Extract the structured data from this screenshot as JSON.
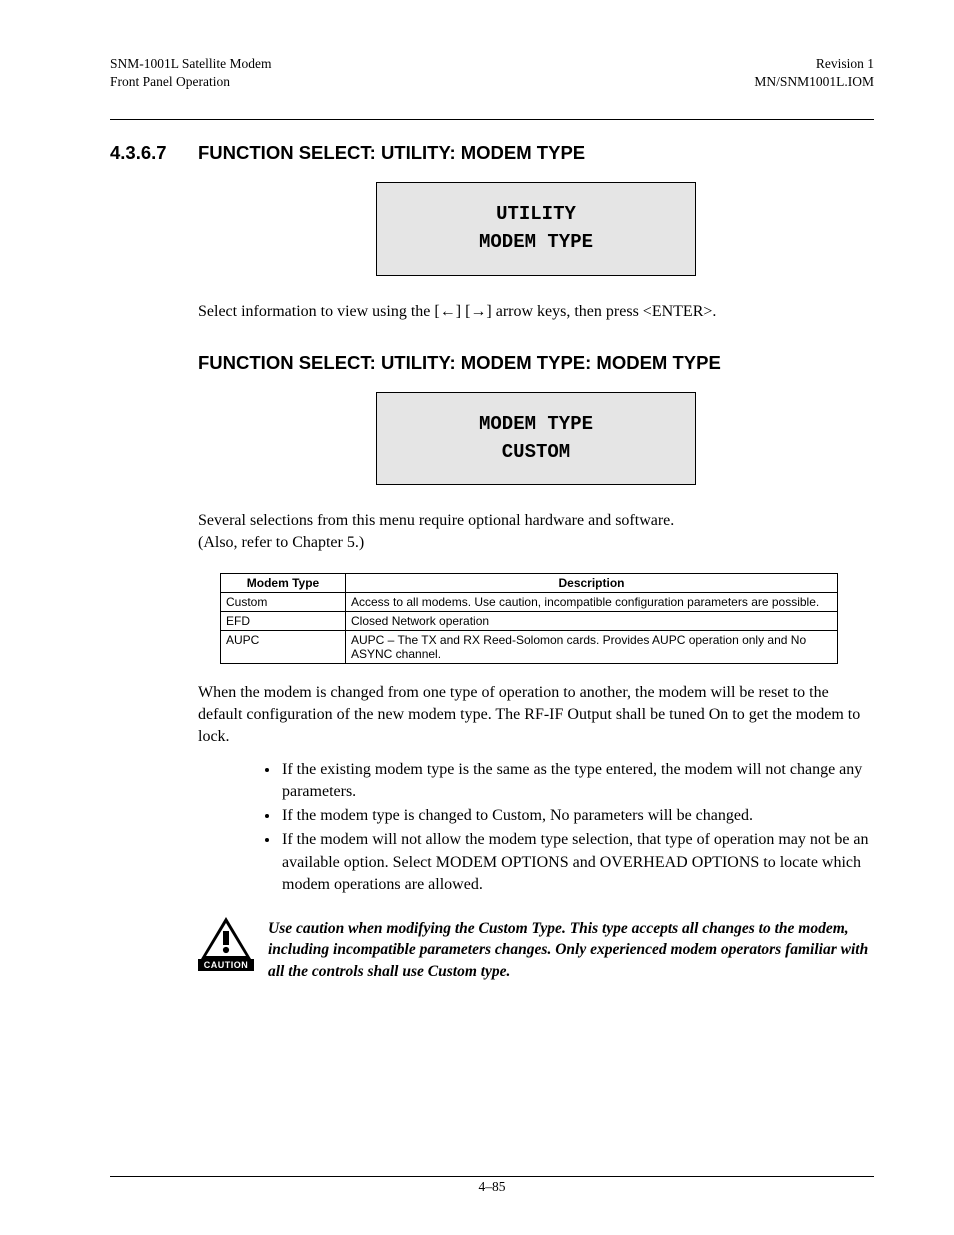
{
  "header": {
    "left1": "SNM-1001L Satellite Modem",
    "left2": "Front Panel Operation",
    "right1": "Revision 1",
    "right2": "MN/SNM1001L.IOM"
  },
  "section": {
    "num": "4.3.6.7",
    "title": "FUNCTION SELECT: UTILITY: MODEM TYPE"
  },
  "lcd1": {
    "line1": "UTILITY",
    "line2": "MODEM TYPE"
  },
  "para1_pre": "Select information to view using the [",
  "para1_mid": "] [",
  "para1_post": "] arrow keys, then press <ENTER>.",
  "subheading": "FUNCTION SELECT: UTILITY: MODEM TYPE: MODEM TYPE",
  "lcd2": {
    "line1": "MODEM TYPE",
    "line2": "CUSTOM"
  },
  "para2a": "Several selections from this menu require optional hardware and software.",
  "para2b": "(Also, refer to Chapter 5.)",
  "table": {
    "head1": "Modem Type",
    "head2": "Description",
    "rows": [
      {
        "type": "Custom",
        "desc": "Access to all modems. Use caution, incompatible configuration parameters are possible."
      },
      {
        "type": "EFD",
        "desc": "Closed Network operation"
      },
      {
        "type": "AUPC",
        "desc": "AUPC – The TX and RX Reed-Solomon cards. Provides AUPC operation only and No ASYNC channel."
      }
    ]
  },
  "para3": "When the modem is changed from one type of operation to another, the modem will be reset to the default configuration of the new modem type. The RF-IF Output shall be tuned On to get the modem to lock.",
  "bullets": [
    "If the existing modem type is the same as the type entered, the modem will not change any parameters.",
    "If the modem type is changed to Custom, No parameters will be changed.",
    "If the modem will not allow the modem type selection, that type of operation may not be an available option. Select MODEM OPTIONS and OVERHEAD OPTIONS to locate which modem operations are allowed."
  ],
  "caution": {
    "label": "CAUTION",
    "text": "Use caution when modifying the Custom Type. This type accepts all changes to the modem, including incompatible parameters changes. Only experienced modem operators familiar with all the controls shall use Custom type."
  },
  "footer": {
    "pagenum": "4–85"
  }
}
